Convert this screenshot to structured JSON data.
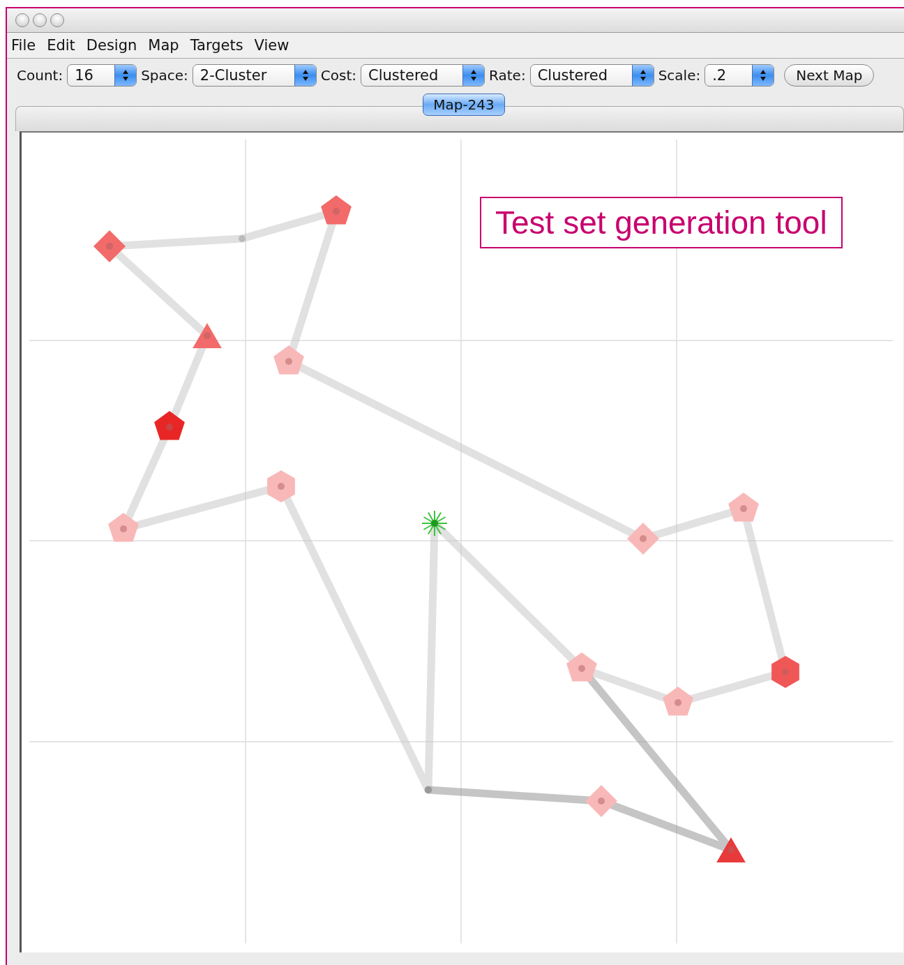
{
  "menu": [
    {
      "label": "File"
    },
    {
      "label": "Edit"
    },
    {
      "label": "Design"
    },
    {
      "label": "Map"
    },
    {
      "label": "Targets"
    },
    {
      "label": "View"
    }
  ],
  "toolbar": {
    "selectors": [
      {
        "label": "Count:",
        "value": "16"
      },
      {
        "label": "Space:",
        "value": "2-Cluster"
      },
      {
        "label": "Cost:",
        "value": "Clustered"
      },
      {
        "label": "Rate:",
        "value": "Clustered"
      },
      {
        "label": "Scale:",
        "value": ".2"
      }
    ],
    "button": "Next Map"
  },
  "tabs": [
    {
      "label": "Map-243",
      "selected": true
    }
  ],
  "map": {
    "targets": [
      {
        "kind": "diamond",
        "color": "#f26a6a"
      },
      {
        "kind": "pentagon",
        "color": "#f26a6a"
      },
      {
        "kind": "triangle",
        "color": "#f26a6a"
      },
      {
        "kind": "pentagon",
        "color": "#f9b8b8"
      },
      {
        "kind": "pentagon",
        "color": "#e82626"
      },
      {
        "kind": "hexagon",
        "color": "#f9b8b8"
      },
      {
        "kind": "pentagon",
        "color": "#f9b8b8"
      },
      {
        "kind": "diamond",
        "color": "#f9b8b8"
      },
      {
        "kind": "pentagon",
        "color": "#f9b8b8"
      },
      {
        "kind": "hexagon",
        "color": "#f05858"
      },
      {
        "kind": "pentagon",
        "color": "#f9b8b8"
      },
      {
        "kind": "pentagon",
        "color": "#f9b8b8"
      },
      {
        "kind": "diamond",
        "color": "#f9b8b8"
      },
      {
        "kind": "triangle",
        "color": "#e83a3a"
      }
    ]
  },
  "callout": "Test set generation tool"
}
